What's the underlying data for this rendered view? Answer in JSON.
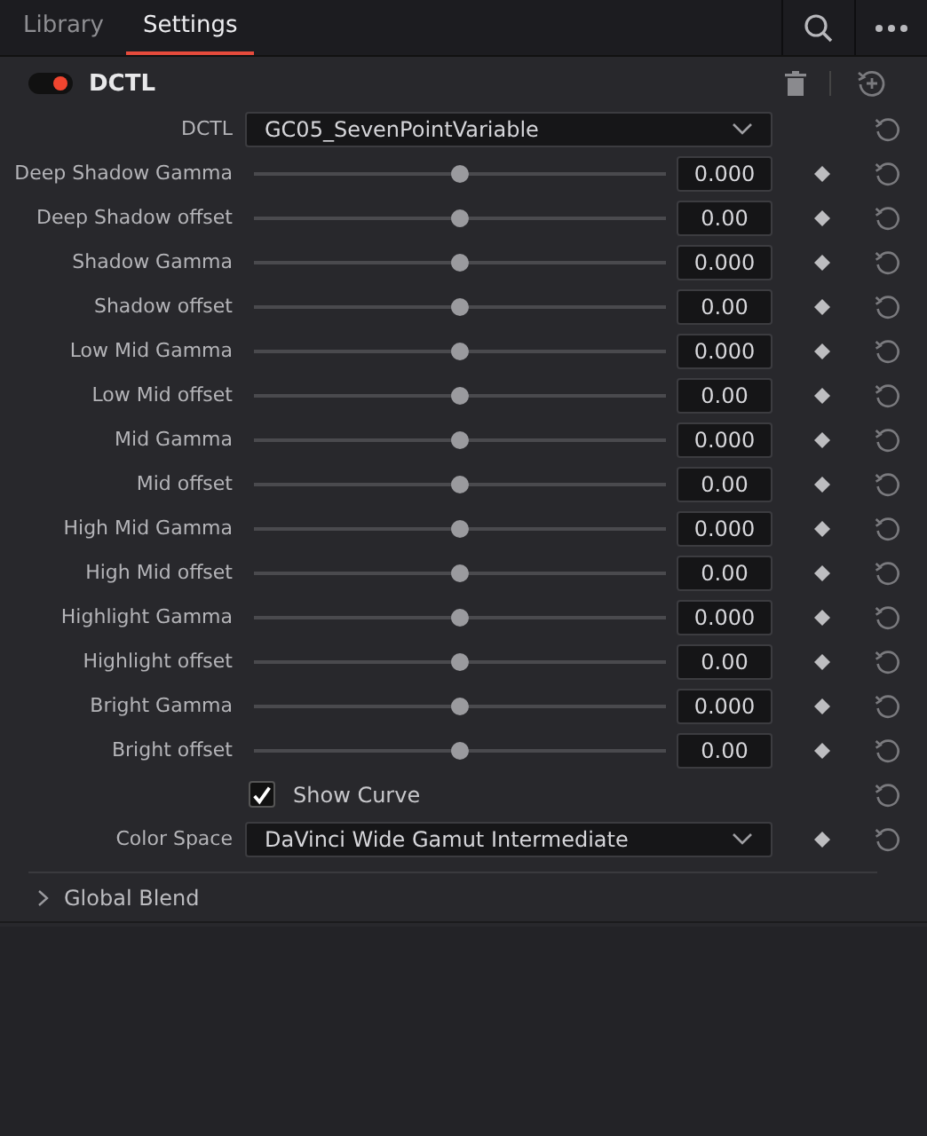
{
  "tabs": [
    {
      "label": "Library",
      "selected": false
    },
    {
      "label": "Settings",
      "selected": true
    }
  ],
  "section": {
    "title": "DCTL",
    "enabled": true
  },
  "rows": [
    {
      "kind": "dropdown",
      "label": "DCTL",
      "value": "GC05_SevenPointVariable",
      "keyframe": false
    },
    {
      "kind": "slider",
      "label": "Deep Shadow Gamma",
      "level": 0.5,
      "value": "0.000",
      "keyframe": true
    },
    {
      "kind": "slider",
      "label": "Deep Shadow offset",
      "level": 0.5,
      "value": "0.00",
      "keyframe": true
    },
    {
      "kind": "slider",
      "label": "Shadow Gamma",
      "level": 0.5,
      "value": "0.000",
      "keyframe": true
    },
    {
      "kind": "slider",
      "label": "Shadow offset",
      "level": 0.5,
      "value": "0.00",
      "keyframe": true
    },
    {
      "kind": "slider",
      "label": "Low Mid Gamma",
      "level": 0.5,
      "value": "0.000",
      "keyframe": true
    },
    {
      "kind": "slider",
      "label": "Low Mid offset",
      "level": 0.5,
      "value": "0.00",
      "keyframe": true
    },
    {
      "kind": "slider",
      "label": "Mid Gamma",
      "level": 0.5,
      "value": "0.000",
      "keyframe": true
    },
    {
      "kind": "slider",
      "label": "Mid offset",
      "level": 0.5,
      "value": "0.00",
      "keyframe": true
    },
    {
      "kind": "slider",
      "label": "High Mid Gamma",
      "level": 0.5,
      "value": "0.000",
      "keyframe": true
    },
    {
      "kind": "slider",
      "label": "High Mid offset",
      "level": 0.5,
      "value": "0.00",
      "keyframe": true
    },
    {
      "kind": "slider",
      "label": "Highlight Gamma",
      "level": 0.5,
      "value": "0.000",
      "keyframe": true
    },
    {
      "kind": "slider",
      "label": "Highlight offset",
      "level": 0.5,
      "value": "0.00",
      "keyframe": true
    },
    {
      "kind": "slider",
      "label": "Bright Gamma",
      "level": 0.5,
      "value": "0.000",
      "keyframe": true
    },
    {
      "kind": "slider",
      "label": "Bright offset",
      "level": 0.5,
      "value": "0.00",
      "keyframe": true
    },
    {
      "kind": "checkbox",
      "label": "Show Curve",
      "checked": true,
      "keyframe": false
    },
    {
      "kind": "dropdown",
      "label": "Color Space",
      "value": "DaVinci Wide Gamut Intermediate",
      "keyframe": true
    }
  ],
  "collapsed": {
    "title": "Global Blend",
    "expanded": false
  }
}
